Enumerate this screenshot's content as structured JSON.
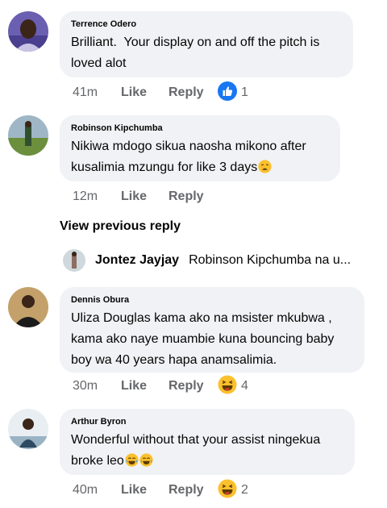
{
  "comments": [
    {
      "author": "Terrence Odero",
      "text": "Brilliant.  Your display on and off the pitch is loved alot",
      "time": "41m",
      "like_label": "Like",
      "reply_label": "Reply",
      "reaction_icon": "like-thumb-icon",
      "reaction_count": "1"
    },
    {
      "author": "Robinson Kipchumba",
      "text": "Nikiwa mdogo sikua naosha mikono after kusalimia mzungu for like 3 days",
      "text_emoji": "weary-face-emoji",
      "time": "12m",
      "like_label": "Like",
      "reply_label": "Reply"
    },
    {
      "author": "Dennis Obura",
      "text": "Uliza Douglas kama ako na msister mkubwa , kama ako naye muambie kuna bouncing baby boy wa 40 years hapa anamsalimia.",
      "time": "30m",
      "like_label": "Like",
      "reply_label": "Reply",
      "reaction_icon": "haha-emoji",
      "reaction_count": "4"
    },
    {
      "author": "Arthur Byron",
      "text": "Wonderful without that your assist ningekua broke leo",
      "text_emoji": "tears-of-joy-emoji x2",
      "time": "40m",
      "like_label": "Like",
      "reply_label": "Reply",
      "reaction_icon": "haha-emoji",
      "reaction_count": "2"
    }
  ],
  "view_previous_label": "View previous reply",
  "collapsed_reply": {
    "author": "Jontez Jayjay",
    "snippet": "Robinson Kipchumba na u..."
  },
  "colors": {
    "bubble_bg": "#f0f2f5",
    "meta_text": "#65676b",
    "like_blue": "#1877f2",
    "emoji_yellow": "#fbc02d"
  }
}
